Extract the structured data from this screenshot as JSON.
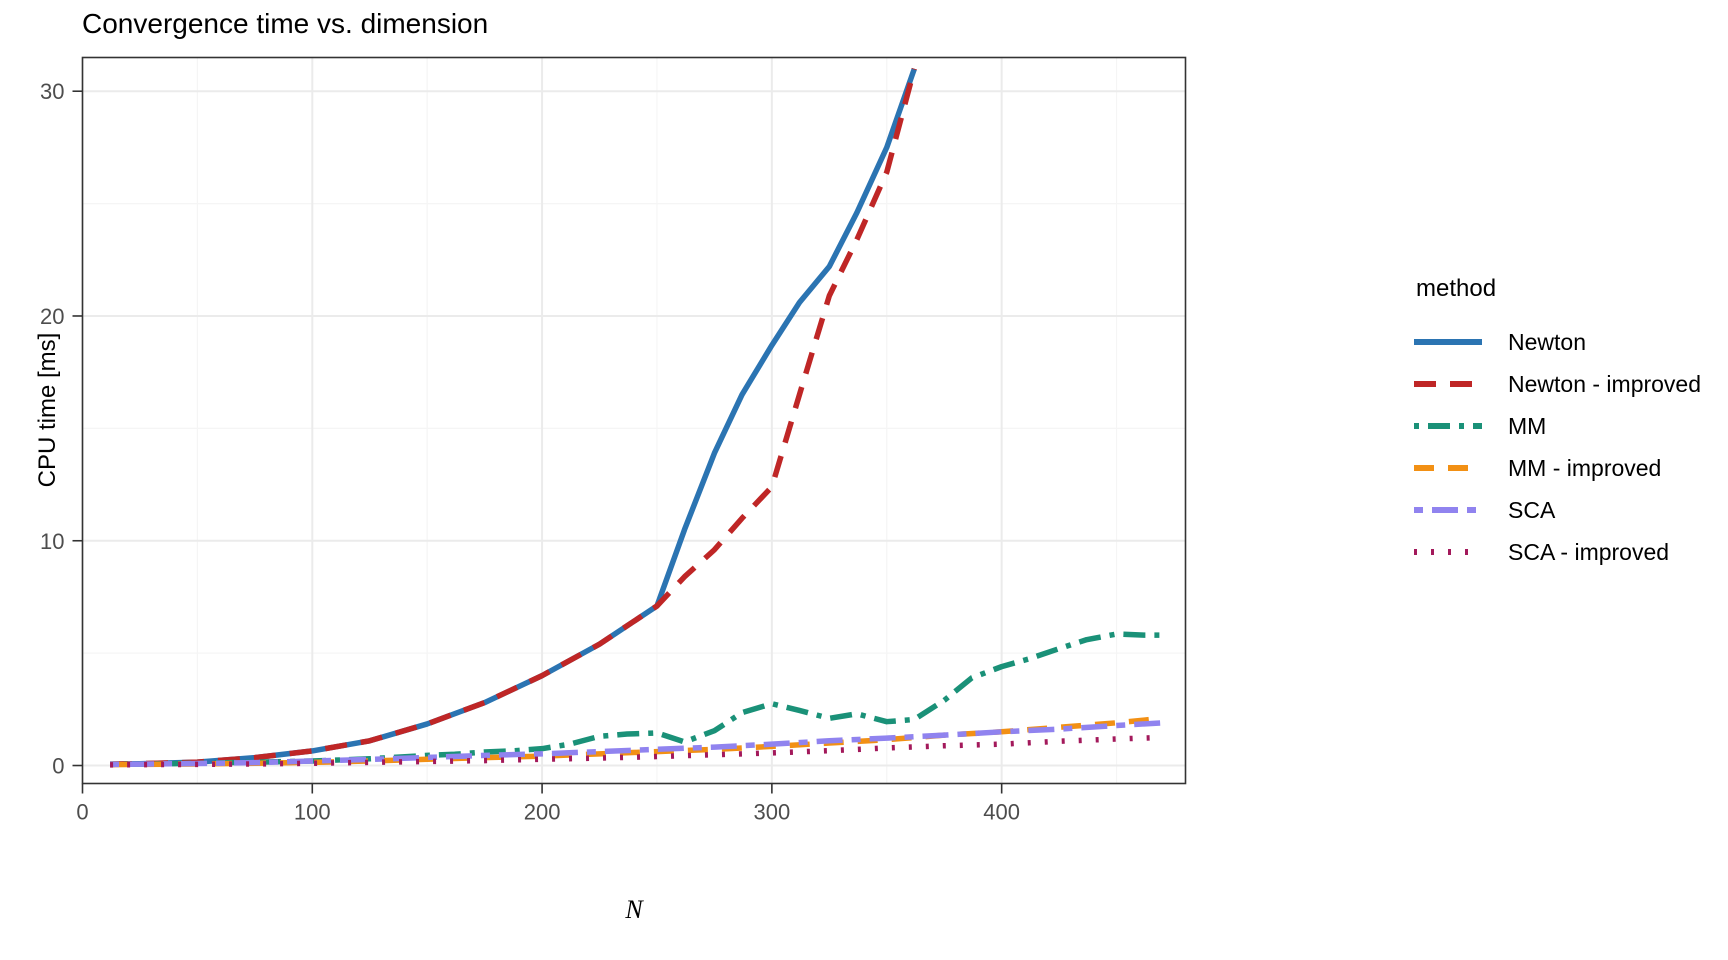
{
  "chart_data": {
    "type": "line",
    "title": "Convergence time vs. dimension",
    "xlabel": "N",
    "ylabel": "CPU time [ms]",
    "legend_title": "method",
    "legend_position": "right",
    "grid": true,
    "xlim": [
      0,
      480
    ],
    "ylim": [
      -0.8,
      31.5
    ],
    "xticks": [
      0,
      100,
      200,
      300,
      400
    ],
    "xtick_labels": [
      "0",
      "100",
      "200",
      "300",
      "400"
    ],
    "yticks": [
      0,
      10,
      20,
      30
    ],
    "ytick_labels": [
      "0",
      "10",
      "20",
      "30"
    ],
    "x_minor_ticks": [
      50,
      150,
      250,
      350,
      450
    ],
    "y_minor_ticks": [
      5,
      15,
      25
    ],
    "series": [
      {
        "name": "Newton",
        "color": "#2b74b2",
        "dash": "none",
        "x": [
          12,
          25,
          50,
          75,
          100,
          125,
          150,
          175,
          200,
          225,
          250,
          262,
          275,
          287,
          300,
          312,
          325,
          337,
          350,
          362
        ],
        "values": [
          0.06,
          0.08,
          0.15,
          0.35,
          0.65,
          1.1,
          1.85,
          2.8,
          4.0,
          5.4,
          7.1,
          10.5,
          13.9,
          16.5,
          18.7,
          20.6,
          22.2,
          24.6,
          27.5,
          31.0
        ]
      },
      {
        "name": "Newton - improved",
        "color": "#bf2626",
        "dash": "22 14",
        "x": [
          12,
          25,
          50,
          75,
          100,
          125,
          150,
          175,
          200,
          225,
          250,
          262,
          275,
          287,
          300,
          312,
          325,
          337,
          350,
          362
        ],
        "values": [
          0.06,
          0.08,
          0.15,
          0.35,
          0.65,
          1.1,
          1.85,
          2.8,
          4.0,
          5.4,
          7.1,
          8.4,
          9.6,
          11.0,
          12.4,
          16.5,
          20.9,
          23.4,
          26.4,
          31.0
        ]
      },
      {
        "name": "MM",
        "color": "#1a9178",
        "dash": "5 9 22 9",
        "x": [
          12,
          25,
          50,
          75,
          100,
          125,
          150,
          162,
          175,
          187,
          200,
          212,
          225,
          237,
          250,
          262,
          275,
          287,
          300,
          312,
          325,
          337,
          350,
          362,
          375,
          387,
          400,
          412,
          425,
          437,
          450,
          462,
          470
        ],
        "values": [
          0.05,
          0.06,
          0.1,
          0.15,
          0.2,
          0.3,
          0.45,
          0.5,
          0.6,
          0.65,
          0.75,
          0.95,
          1.3,
          1.4,
          1.45,
          1.05,
          1.55,
          2.35,
          2.75,
          2.45,
          2.1,
          2.3,
          1.95,
          2.05,
          2.9,
          3.9,
          4.4,
          4.75,
          5.2,
          5.6,
          5.85,
          5.8,
          5.8
        ]
      },
      {
        "name": "MM - improved",
        "color": "#f29014",
        "dash": "20 14",
        "x": [
          12,
          25,
          50,
          75,
          100,
          125,
          150,
          175,
          200,
          225,
          250,
          275,
          300,
          325,
          350,
          375,
          400,
          425,
          450,
          470
        ],
        "values": [
          0.04,
          0.05,
          0.07,
          0.1,
          0.14,
          0.2,
          0.28,
          0.35,
          0.42,
          0.52,
          0.62,
          0.72,
          0.85,
          1.0,
          1.15,
          1.35,
          1.5,
          1.7,
          1.9,
          2.1
        ]
      },
      {
        "name": "SCA",
        "color": "#9083ef",
        "dash": "9 9 26 9",
        "x": [
          12,
          25,
          50,
          75,
          100,
          125,
          150,
          175,
          200,
          225,
          250,
          275,
          300,
          325,
          350,
          375,
          400,
          425,
          450,
          470
        ],
        "values": [
          0.05,
          0.06,
          0.09,
          0.13,
          0.2,
          0.27,
          0.36,
          0.45,
          0.52,
          0.62,
          0.72,
          0.82,
          0.95,
          1.1,
          1.22,
          1.35,
          1.5,
          1.62,
          1.78,
          1.9
        ]
      },
      {
        "name": "SCA - improved",
        "color": "#a3195b",
        "dash": "3 14",
        "x": [
          12,
          25,
          50,
          75,
          100,
          125,
          150,
          175,
          200,
          225,
          250,
          275,
          300,
          325,
          350,
          375,
          400,
          425,
          450,
          470
        ],
        "values": [
          0.03,
          0.04,
          0.05,
          0.07,
          0.1,
          0.14,
          0.18,
          0.22,
          0.28,
          0.33,
          0.4,
          0.48,
          0.56,
          0.66,
          0.78,
          0.88,
          0.95,
          1.08,
          1.18,
          1.25
        ]
      }
    ]
  },
  "panel": {
    "background": "#ffffff",
    "grid_major_color": "#ebebeb",
    "grid_minor_color": "#f5f5f5",
    "border_color": "#333333"
  }
}
